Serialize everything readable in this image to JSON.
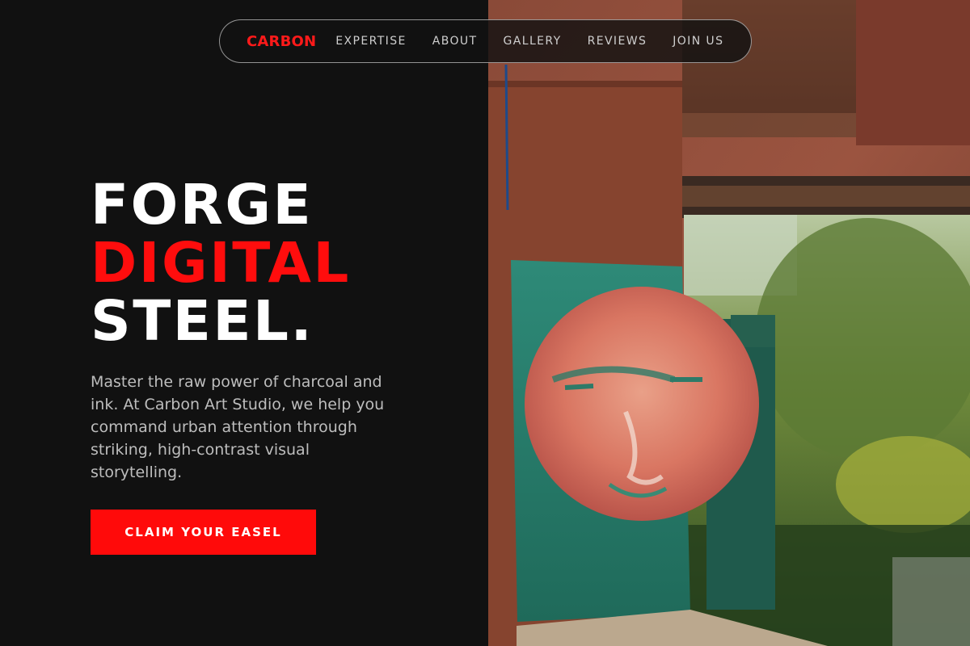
{
  "nav": {
    "logo": "CARBON",
    "links": [
      "EXPERTISE",
      "ABOUT",
      "GALLERY",
      "REVIEWS",
      "JOIN US"
    ]
  },
  "hero": {
    "headline": [
      "FORGE",
      "DIGITAL",
      "STEEL."
    ],
    "subtext": "Master the raw power of charcoal and ink. At Carbon Art Studio, we help you command urban attention through striking, high-contrast visual storytelling.",
    "cta_label": "CLAIM YOUR EASEL",
    "image_description_icon": "painted-face-on-rusted-steel-photo"
  },
  "colors": {
    "background": "#111111",
    "accent": "#ff0d0d",
    "text_primary": "#ffffff",
    "text_secondary": "#bdbdbd"
  }
}
